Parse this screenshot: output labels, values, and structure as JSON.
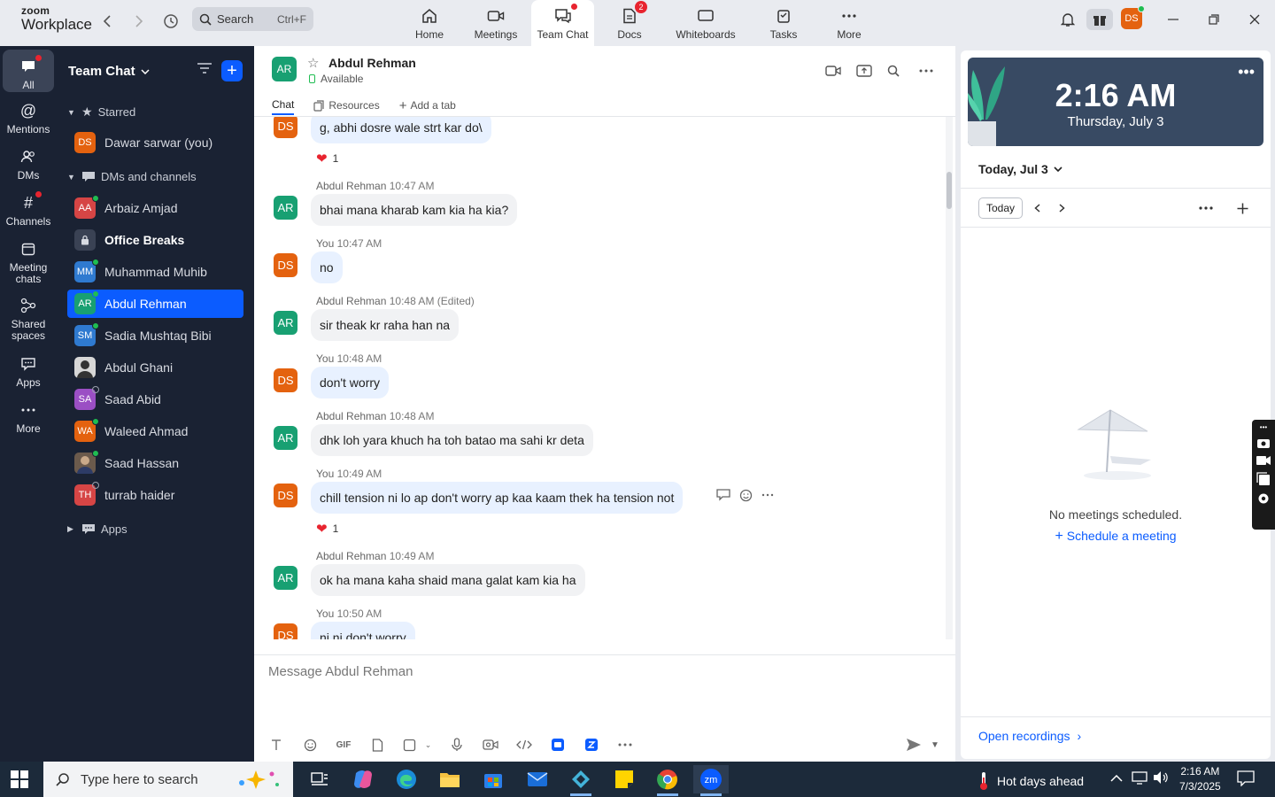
{
  "app": {
    "logo_line1": "zoom",
    "logo_line2": "Workplace"
  },
  "search": {
    "placeholder": "Search",
    "shortcut": "Ctrl+F"
  },
  "top_tabs": [
    {
      "label": "Home",
      "icon": "home-icon"
    },
    {
      "label": "Meetings",
      "icon": "video-camera-icon"
    },
    {
      "label": "Team Chat",
      "icon": "chat-bubbles-icon",
      "active": true
    },
    {
      "label": "Docs",
      "icon": "docs-icon",
      "badge": "2"
    },
    {
      "label": "Whiteboards",
      "icon": "whiteboard-icon"
    },
    {
      "label": "Tasks",
      "icon": "tasks-icon"
    },
    {
      "label": "More",
      "icon": "more-dots-icon"
    }
  ],
  "account": {
    "initials": "DS"
  },
  "rail": {
    "all": "All",
    "mentions": "Mentions",
    "dms": "DMs",
    "channels": "Channels",
    "meeting_chats_1": "Meeting",
    "meeting_chats_2": "chats",
    "shared_spaces_1": "Shared",
    "shared_spaces_2": "spaces",
    "apps": "Apps",
    "more": "More"
  },
  "sidebar": {
    "title": "Team Chat",
    "starred": "Starred",
    "dms_channels": "DMs and channels",
    "apps": "Apps",
    "starred_items": [
      {
        "initials": "DS",
        "name": "Dawar sarwar (you)",
        "color": "#e4620f"
      }
    ],
    "items": [
      {
        "initials": "AA",
        "name": "Arbaiz Amjad",
        "color": "#d64545",
        "status": "on"
      },
      {
        "initials": "",
        "name": "Office Breaks",
        "color": "#3a4254",
        "bold": true,
        "lock": true
      },
      {
        "initials": "MM",
        "name": "Muhammad Muhib",
        "color": "#2f7ad0",
        "status": "on"
      },
      {
        "initials": "AR",
        "name": "Abdul Rehman",
        "color": "#18a072",
        "status": "on",
        "selected": true
      },
      {
        "initials": "SM",
        "name": "Sadia Mushtaq Bibi",
        "color": "#2f7ad0",
        "status": "on"
      },
      {
        "initials": "",
        "name": "Abdul Ghani",
        "color": "#777c86",
        "photo": true
      },
      {
        "initials": "SA",
        "name": "Saad Abid",
        "color": "#9b4fc4",
        "status": "off"
      },
      {
        "initials": "WA",
        "name": "Waleed Ahmad",
        "color": "#e4620f",
        "status": "on"
      },
      {
        "initials": "",
        "name": "Saad Hassan",
        "color": "#6b5a4c",
        "photo": true,
        "status": "on"
      },
      {
        "initials": "TH",
        "name": "turrab haider",
        "color": "#d64545",
        "status": "off"
      }
    ]
  },
  "chat": {
    "contact_initials": "AR",
    "contact_name": "Abdul Rehman",
    "contact_status": "Available",
    "tabs": {
      "chat": "Chat",
      "resources": "Resources",
      "add_tab": "Add a tab"
    },
    "messages": [
      {
        "side": "mine",
        "avatar": "DS",
        "text": "g, abhi dosre wale strt kar do\\",
        "reaction": "1"
      },
      {
        "side": "theirs",
        "avatar": "AR",
        "sender": "Abdul Rehman",
        "time": "10:47 AM",
        "text": "bhai mana kharab kam kia ha kia?"
      },
      {
        "side": "mine",
        "avatar": "DS",
        "sender": "You",
        "time": "10:47 AM",
        "text": "no"
      },
      {
        "side": "theirs",
        "avatar": "AR",
        "sender": "Abdul Rehman",
        "time": "10:48 AM (Edited)",
        "text": "sir theak kr raha han na"
      },
      {
        "side": "mine",
        "avatar": "DS",
        "sender": "You",
        "time": "10:48 AM",
        "text": "don't worry"
      },
      {
        "side": "theirs",
        "avatar": "AR",
        "sender": "Abdul Rehman",
        "time": "10:48 AM",
        "text": "dhk loh yara khuch ha toh batao ma sahi kr deta"
      },
      {
        "side": "mine",
        "avatar": "DS",
        "sender": "You",
        "time": "10:49 AM",
        "text": "chill tension ni lo ap don't worry ap kaa kaam thek ha tension not",
        "reaction": "1"
      },
      {
        "side": "theirs",
        "avatar": "AR",
        "sender": "Abdul Rehman",
        "time": "10:49 AM",
        "text": "ok ha mana kaha shaid mana galat kam kia ha"
      },
      {
        "side": "mine",
        "avatar": "DS",
        "sender": "You",
        "time": "10:50 AM",
        "text": "ni ni don't worry"
      }
    ],
    "composer_placeholder": "Message Abdul Rehman",
    "gif_label": "GIF"
  },
  "right": {
    "time": "2:16 AM",
    "date": "Thursday, July 3",
    "day_selector": "Today, Jul 3",
    "today_button": "Today",
    "empty_text": "No meetings scheduled.",
    "schedule_link": "Schedule a meeting",
    "recordings_link": "Open recordings"
  },
  "taskbar": {
    "search_placeholder": "Type here to search",
    "weather": "Hot days ahead",
    "clock_time": "2:16 AM",
    "clock_date": "7/3/2025"
  }
}
